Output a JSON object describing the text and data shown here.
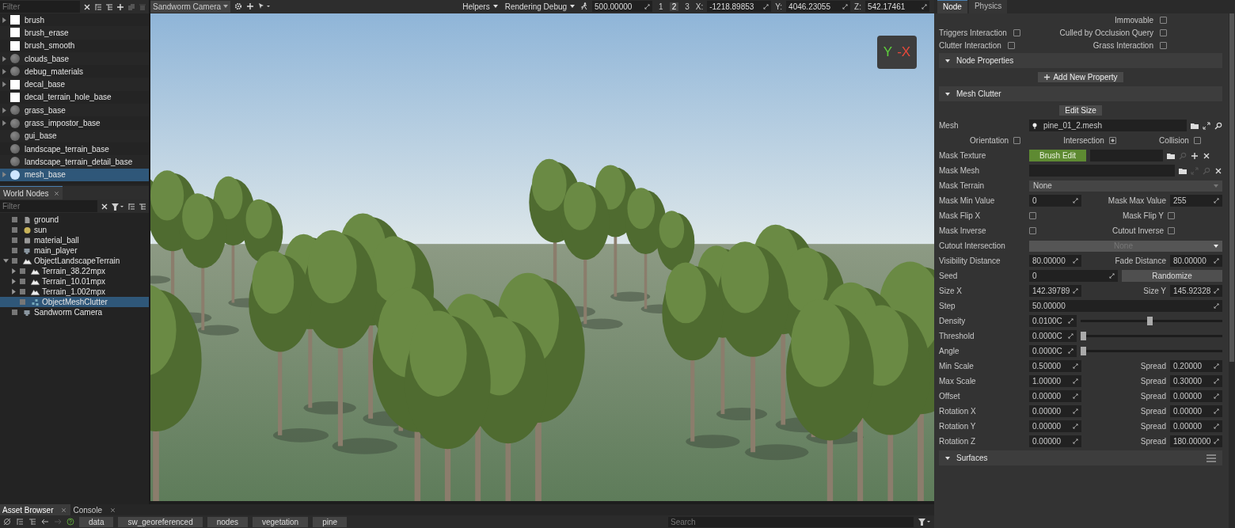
{
  "asset_tree": {
    "filter_placeholder": "Filter",
    "items": [
      {
        "name": "brush",
        "kind": "texture",
        "expandable": true,
        "selected": false
      },
      {
        "name": "brush_erase",
        "kind": "texture",
        "expandable": false,
        "selected": false
      },
      {
        "name": "brush_smooth",
        "kind": "texture",
        "expandable": false,
        "selected": false
      },
      {
        "name": "clouds_base",
        "kind": "material",
        "expandable": true,
        "selected": false
      },
      {
        "name": "debug_materials",
        "kind": "material",
        "expandable": true,
        "selected": false
      },
      {
        "name": "decal_base",
        "kind": "texture",
        "expandable": true,
        "selected": false
      },
      {
        "name": "decal_terrain_hole_base",
        "kind": "texture",
        "expandable": false,
        "selected": false
      },
      {
        "name": "grass_base",
        "kind": "material",
        "expandable": true,
        "selected": false
      },
      {
        "name": "grass_impostor_base",
        "kind": "material",
        "expandable": true,
        "selected": false
      },
      {
        "name": "gui_base",
        "kind": "material",
        "expandable": false,
        "selected": false
      },
      {
        "name": "landscape_terrain_base",
        "kind": "material",
        "expandable": false,
        "selected": false
      },
      {
        "name": "landscape_terrain_detail_base",
        "kind": "material",
        "expandable": false,
        "selected": false
      },
      {
        "name": "mesh_base",
        "kind": "material",
        "expandable": true,
        "selected": true
      }
    ]
  },
  "world_nodes": {
    "tab": "World Nodes",
    "filter_placeholder": "Filter",
    "items": [
      {
        "name": "ground",
        "kind": "file",
        "selected": false
      },
      {
        "name": "sun",
        "kind": "sun",
        "selected": false
      },
      {
        "name": "material_ball",
        "kind": "box",
        "selected": false
      },
      {
        "name": "main_player",
        "kind": "player",
        "selected": false
      },
      {
        "name": "ObjectLandscapeTerrain",
        "kind": "terrain",
        "expanded": true,
        "selected": false,
        "children": [
          {
            "name": "Terrain_38.22mpx",
            "kind": "terrain",
            "expanded": false,
            "selected": false
          },
          {
            "name": "Terrain_10.01mpx",
            "kind": "terrain",
            "expanded": false,
            "selected": false
          },
          {
            "name": "Terrain_1.002mpx",
            "kind": "terrain",
            "expanded": false,
            "selected": false
          },
          {
            "name": "ObjectMeshClutter",
            "kind": "clutter",
            "selected": true
          }
        ]
      },
      {
        "name": "Sandworm Camera",
        "kind": "player",
        "selected": false
      }
    ]
  },
  "viewport_toolbar": {
    "camera": "Sandworm Camera",
    "helpers": "Helpers",
    "rendering": "Rendering Debug",
    "speed": "500.00000",
    "views": [
      {
        "label": "1",
        "selected": false
      },
      {
        "label": "2",
        "selected": true
      },
      {
        "label": "3",
        "selected": false
      }
    ],
    "coords": [
      {
        "axis": "X:",
        "value": "-1218.89853"
      },
      {
        "axis": "Y:",
        "value": "4046.23055"
      },
      {
        "axis": "Z:",
        "value": "542.17461"
      }
    ]
  },
  "gizmo": {
    "y": "Y",
    "x": "-X"
  },
  "inspector": {
    "tabs": [
      {
        "label": "Node",
        "selected": true
      },
      {
        "label": "Physics",
        "selected": false
      }
    ],
    "rows": [
      {
        "kind": "flags",
        "right": {
          "label": "Immovable",
          "checked": false
        }
      },
      {
        "kind": "flags",
        "left": {
          "label": "Triggers Interaction",
          "checked": false
        },
        "right": {
          "label": "Culled by Occlusion Query",
          "checked": false
        }
      },
      {
        "kind": "flags",
        "left": {
          "label": "Clutter Interaction",
          "checked": false
        },
        "right": {
          "label": "Grass Interaction",
          "checked": false
        }
      },
      {
        "kind": "section",
        "title": "Node Properties",
        "menu": false
      },
      {
        "kind": "add-button",
        "label": "Add New Property"
      },
      {
        "kind": "section",
        "title": "Mesh Clutter",
        "menu": false
      },
      {
        "kind": "button",
        "label": "Edit Size"
      },
      {
        "kind": "mesh",
        "label": "Mesh",
        "value": "pine_01_2.mesh"
      },
      {
        "kind": "inline-checks",
        "items": [
          {
            "label": "Orientation",
            "checked": false
          },
          {
            "label": "Intersection",
            "checked": true
          },
          {
            "label": "Collision",
            "checked": false
          }
        ]
      },
      {
        "kind": "mask-texture",
        "label": "Mask Texture",
        "button": "Brush Edit"
      },
      {
        "kind": "mask-mesh",
        "label": "Mask Mesh"
      },
      {
        "kind": "dropdown",
        "label": "Mask Terrain",
        "value": "None",
        "disabled": false
      },
      {
        "kind": "pair",
        "label": "Mask Min Value",
        "value": "0",
        "label2": "Mask Max Value",
        "value2": "255"
      },
      {
        "kind": "check-pair",
        "label": "Mask Flip X",
        "checked": false,
        "label2": "Mask Flip Y",
        "checked2": false
      },
      {
        "kind": "check-pair",
        "label": "Mask Inverse",
        "checked": false,
        "label2": "Cutout Inverse",
        "checked2": false
      },
      {
        "kind": "dropdown",
        "label": "Cutout Intersection",
        "value": "None",
        "disabled": true
      },
      {
        "kind": "pair",
        "label": "Visibility Distance",
        "value": "80.00000",
        "label2": "Fade Distance",
        "value2": "80.00000"
      },
      {
        "kind": "seed",
        "label": "Seed",
        "value": "0",
        "button": "Randomize"
      },
      {
        "kind": "pair",
        "label": "Size X",
        "value": "142.39789",
        "label2": "Size Y",
        "value2": "145.92328"
      },
      {
        "kind": "field",
        "label": "Step",
        "value": "50.00000"
      },
      {
        "kind": "slider",
        "label": "Density",
        "value": "0.0100C",
        "level": 0.49
      },
      {
        "kind": "slider",
        "label": "Threshold",
        "value": "0.0000C",
        "level": 0
      },
      {
        "kind": "slider",
        "label": "Angle",
        "value": "0.0000C",
        "level": 0
      },
      {
        "kind": "pair",
        "label": "Min Scale",
        "value": "0.50000",
        "label2": "Spread",
        "value2": "0.20000"
      },
      {
        "kind": "pair",
        "label": "Max Scale",
        "value": "1.00000",
        "label2": "Spread",
        "value2": "0.30000"
      },
      {
        "kind": "pair",
        "label": "Offset",
        "value": "0.00000",
        "label2": "Spread",
        "value2": "0.00000"
      },
      {
        "kind": "pair",
        "label": "Rotation X",
        "value": "0.00000",
        "label2": "Spread",
        "value2": "0.00000"
      },
      {
        "kind": "pair",
        "label": "Rotation Y",
        "value": "0.00000",
        "label2": "Spread",
        "value2": "0.00000"
      },
      {
        "kind": "pair",
        "label": "Rotation Z",
        "value": "0.00000",
        "label2": "Spread",
        "value2": "180.00000"
      },
      {
        "kind": "section",
        "title": "Surfaces",
        "menu": true
      }
    ]
  },
  "bottom_panel": {
    "tabs": [
      {
        "label": "Asset Browser",
        "selected": true
      },
      {
        "label": "Console",
        "selected": false
      }
    ],
    "breadcrumbs": [
      "data",
      "sw_georeferenced",
      "nodes",
      "vegetation",
      "pine"
    ],
    "search_placeholder": "Search"
  }
}
